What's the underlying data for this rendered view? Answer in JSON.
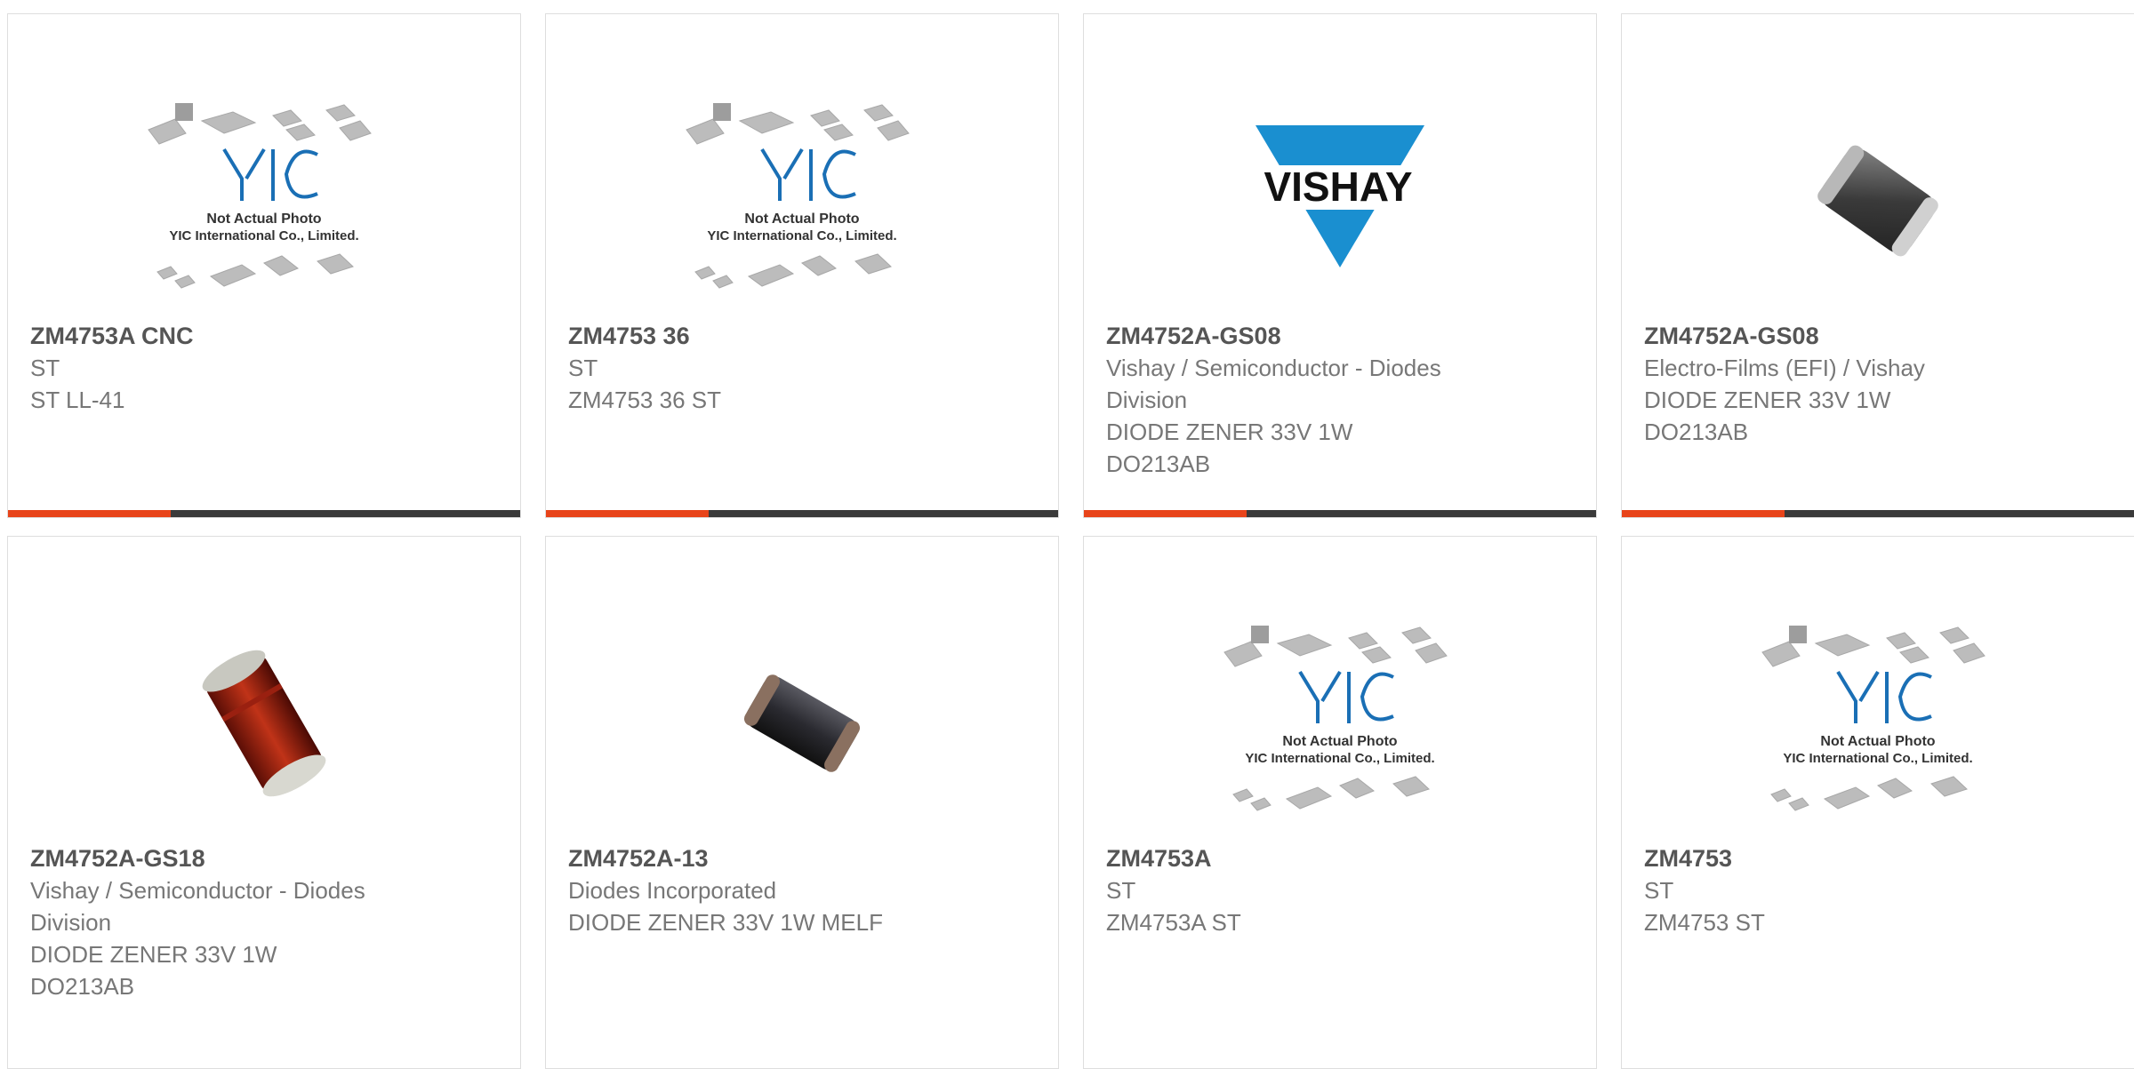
{
  "cards": [
    {
      "title": "ZM4753A CNC",
      "lines": [
        "ST",
        "ST LL-41"
      ],
      "image": "yic-placeholder",
      "image_text": [
        "Not Actual Photo",
        "YIC International Co., Limited."
      ],
      "accent": true
    },
    {
      "title": "ZM4753 36",
      "lines": [
        "ST",
        "ZM4753 36 ST"
      ],
      "image": "yic-placeholder",
      "image_text": [
        "Not Actual Photo",
        "YIC International Co., Limited."
      ],
      "accent": true
    },
    {
      "title": "ZM4752A-GS08",
      "lines": [
        "Vishay / Semiconductor - Diodes",
        "Division",
        "DIODE ZENER 33V 1W",
        "DO213AB"
      ],
      "image": "vishay-logo",
      "image_text": [
        "VISHAY"
      ],
      "accent": true
    },
    {
      "title": "ZM4752A-GS08",
      "lines": [
        "Electro-Films (EFI) / Vishay",
        "DIODE ZENER 33V 1W",
        "DO213AB"
      ],
      "image": "diode-grey",
      "accent": true
    },
    {
      "title": "ZM4752A-GS18",
      "lines": [
        "Vishay / Semiconductor - Diodes",
        "Division",
        "DIODE ZENER 33V 1W",
        "DO213AB"
      ],
      "image": "diode-red"
    },
    {
      "title": "ZM4752A-13",
      "lines": [
        "Diodes Incorporated",
        "DIODE ZENER 33V 1W MELF"
      ],
      "image": "diode-black"
    },
    {
      "title": "ZM4753A",
      "lines": [
        "ST",
        "ZM4753A ST"
      ],
      "image": "yic-placeholder",
      "image_text": [
        "Not Actual Photo",
        "YIC International Co., Limited."
      ]
    },
    {
      "title": "ZM4753",
      "lines": [
        "ST",
        "ZM4753 ST"
      ],
      "image": "yic-placeholder",
      "image_text": [
        "Not Actual Photo",
        "YIC International Co., Limited."
      ]
    }
  ],
  "colors": {
    "accent": "#e8441a",
    "bar": "#3a3a3a",
    "vishay_blue": "#1a8fd0",
    "yic_blue": "#1a6fb5"
  }
}
